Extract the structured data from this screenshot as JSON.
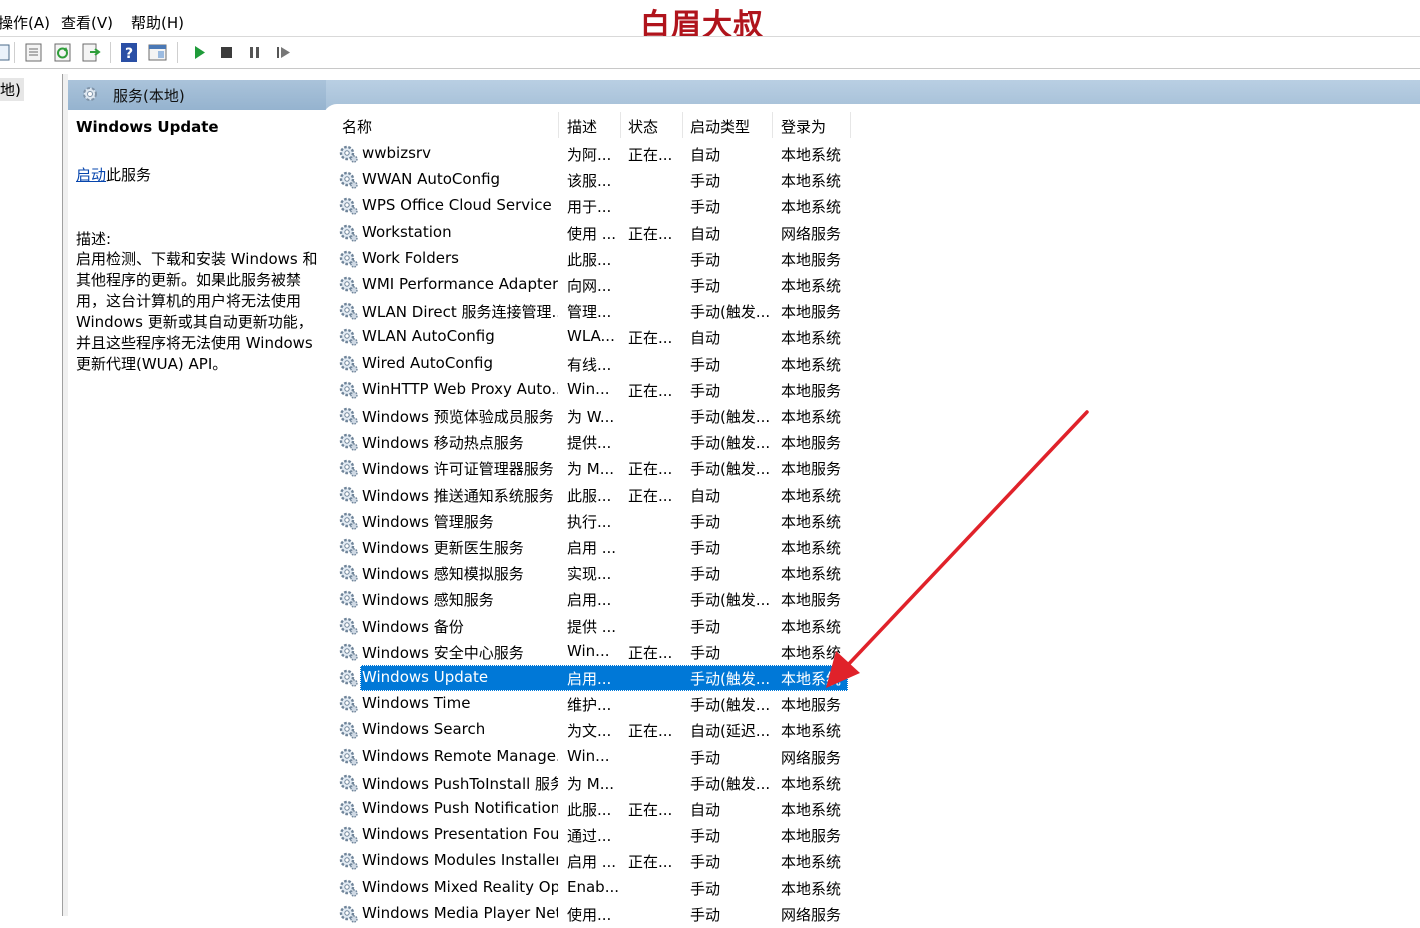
{
  "menu": {
    "items": [
      "操作(A)",
      "查看(V)",
      "帮助(H)"
    ],
    "watermark": "白眉大叔"
  },
  "toolbar": {
    "icons": [
      "console-tree-icon",
      "properties-icon",
      "refresh-icon",
      "export-list-icon",
      "help-icon",
      "show-hide-icon",
      "start-service-icon",
      "stop-service-icon",
      "pause-service-icon",
      "restart-service-icon"
    ]
  },
  "tree": {
    "item_label": "地)"
  },
  "panel": {
    "title": "服务(本地)"
  },
  "details": {
    "service_name": "Windows Update",
    "start_link": "启动",
    "start_suffix": "此服务",
    "desc_label": "描述:",
    "description": "启用检测、下载和安装 Windows 和其他程序的更新。如果此服务被禁用，这台计算机的用户将无法使用 Windows 更新或其自动更新功能，并且这些程序将无法使用 Windows 更新代理(WUA) API。"
  },
  "columns": {
    "name": "名称",
    "desc": "描述",
    "state": "状态",
    "startup": "启动类型",
    "logon": "登录为"
  },
  "services": [
    {
      "name": "wwbizsrv",
      "desc": "为阿...",
      "state": "正在...",
      "startup": "自动",
      "logon": "本地系统"
    },
    {
      "name": "WWAN AutoConfig",
      "desc": "该服...",
      "state": "",
      "startup": "手动",
      "logon": "本地系统"
    },
    {
      "name": "WPS Office Cloud Service",
      "desc": "用于...",
      "state": "",
      "startup": "手动",
      "logon": "本地系统"
    },
    {
      "name": "Workstation",
      "desc": "使用 ...",
      "state": "正在...",
      "startup": "自动",
      "logon": "网络服务"
    },
    {
      "name": "Work Folders",
      "desc": "此服...",
      "state": "",
      "startup": "手动",
      "logon": "本地服务"
    },
    {
      "name": "WMI Performance Adapter",
      "desc": "向网...",
      "state": "",
      "startup": "手动",
      "logon": "本地系统"
    },
    {
      "name": "WLAN Direct 服务连接管理...",
      "desc": "管理...",
      "state": "",
      "startup": "手动(触发...",
      "logon": "本地服务"
    },
    {
      "name": "WLAN AutoConfig",
      "desc": "WLA...",
      "state": "正在...",
      "startup": "自动",
      "logon": "本地系统"
    },
    {
      "name": "Wired AutoConfig",
      "desc": "有线...",
      "state": "",
      "startup": "手动",
      "logon": "本地系统"
    },
    {
      "name": "WinHTTP Web Proxy Auto...",
      "desc": "Win...",
      "state": "正在...",
      "startup": "手动",
      "logon": "本地服务"
    },
    {
      "name": "Windows 预览体验成员服务",
      "desc": "为 W...",
      "state": "",
      "startup": "手动(触发...",
      "logon": "本地系统"
    },
    {
      "name": "Windows 移动热点服务",
      "desc": "提供...",
      "state": "",
      "startup": "手动(触发...",
      "logon": "本地服务"
    },
    {
      "name": "Windows 许可证管理器服务",
      "desc": "为 M...",
      "state": "正在...",
      "startup": "手动(触发...",
      "logon": "本地服务"
    },
    {
      "name": "Windows 推送通知系统服务",
      "desc": "此服...",
      "state": "正在...",
      "startup": "自动",
      "logon": "本地系统"
    },
    {
      "name": "Windows 管理服务",
      "desc": "执行...",
      "state": "",
      "startup": "手动",
      "logon": "本地系统"
    },
    {
      "name": "Windows 更新医生服务",
      "desc": "启用 ...",
      "state": "",
      "startup": "手动",
      "logon": "本地系统"
    },
    {
      "name": "Windows 感知模拟服务",
      "desc": "实现...",
      "state": "",
      "startup": "手动",
      "logon": "本地系统"
    },
    {
      "name": "Windows 感知服务",
      "desc": "启用...",
      "state": "",
      "startup": "手动(触发...",
      "logon": "本地服务"
    },
    {
      "name": "Windows 备份",
      "desc": "提供 ...",
      "state": "",
      "startup": "手动",
      "logon": "本地系统"
    },
    {
      "name": "Windows 安全中心服务",
      "desc": "Win...",
      "state": "正在...",
      "startup": "手动",
      "logon": "本地系统"
    },
    {
      "name": "Windows Update",
      "desc": "启用...",
      "state": "",
      "startup": "手动(触发...",
      "logon": "本地系统",
      "selected": true
    },
    {
      "name": "Windows Time",
      "desc": "维护...",
      "state": "",
      "startup": "手动(触发...",
      "logon": "本地服务"
    },
    {
      "name": "Windows Search",
      "desc": "为文...",
      "state": "正在...",
      "startup": "自动(延迟...",
      "logon": "本地系统"
    },
    {
      "name": "Windows Remote Manage...",
      "desc": "Win...",
      "state": "",
      "startup": "手动",
      "logon": "网络服务"
    },
    {
      "name": "Windows PushToInstall 服务",
      "desc": "为 M...",
      "state": "",
      "startup": "手动(触发...",
      "logon": "本地系统"
    },
    {
      "name": "Windows Push Notification...",
      "desc": "此服...",
      "state": "正在...",
      "startup": "自动",
      "logon": "本地系统"
    },
    {
      "name": "Windows Presentation Fou...",
      "desc": "通过...",
      "state": "",
      "startup": "手动",
      "logon": "本地服务"
    },
    {
      "name": "Windows Modules Installer",
      "desc": "启用 ...",
      "state": "正在...",
      "startup": "手动",
      "logon": "本地系统"
    },
    {
      "name": "Windows Mixed Reality Op...",
      "desc": "Enab...",
      "state": "",
      "startup": "手动",
      "logon": "本地系统"
    },
    {
      "name": "Windows Media Player Net...",
      "desc": "使用...",
      "state": "",
      "startup": "手动",
      "logon": "网络服务"
    }
  ],
  "colors": {
    "selection": "#0078d7",
    "link": "#0645ad",
    "arrow": "#e0222a",
    "watermark": "#b0141c"
  }
}
